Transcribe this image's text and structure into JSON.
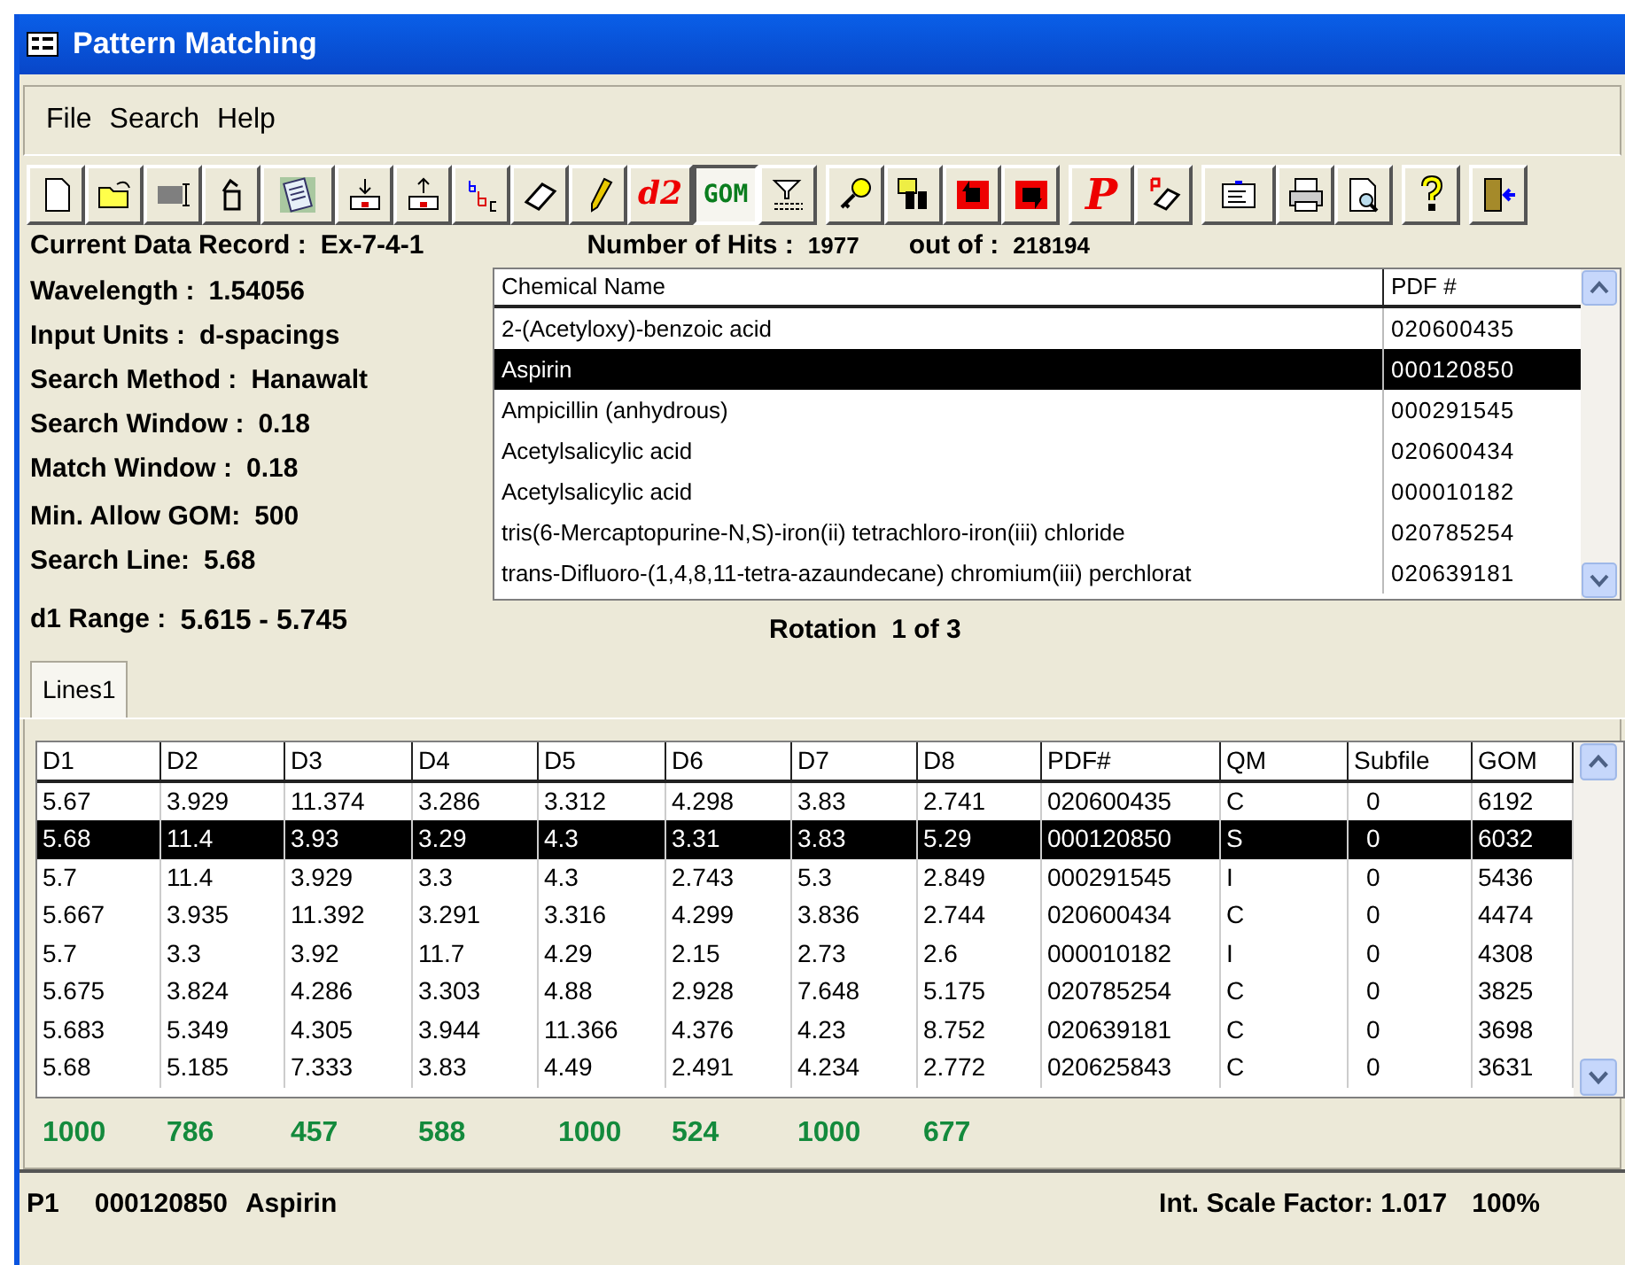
{
  "window": {
    "title": "Pattern Matching"
  },
  "menu": [
    "File",
    "Search",
    "Help"
  ],
  "toolbar": [
    {
      "label": "d2",
      "pressed": false
    },
    {
      "label": "GOM",
      "pressed": true
    },
    {
      "label": "P",
      "pressed": false
    }
  ],
  "record": {
    "label": "Current Data Record :",
    "value": "Ex-7-4-1"
  },
  "hits": {
    "label": "Number of Hits :",
    "value": "1977",
    "total_label": "out of :",
    "total": "218194"
  },
  "parameters": [
    {
      "label": "Wavelength :",
      "value": "1.54056"
    },
    {
      "label": "Input Units :",
      "value": "d-spacings"
    },
    {
      "label": "Search Method :",
      "value": "Hanawalt"
    },
    {
      "label": "Search Window :",
      "value": "0.18"
    },
    {
      "label": "Match Window :",
      "value": "0.18"
    },
    {
      "label": "Min. Allow GOM:",
      "value": "500"
    },
    {
      "label": "Search Line:",
      "value": "5.68"
    },
    {
      "label": "d1 Range :",
      "value": "5.615 - 5.745"
    }
  ],
  "hit_list": {
    "columns": [
      "Chemical Name",
      "PDF #"
    ],
    "rows": [
      {
        "name": "2-(Acetyloxy)-benzoic acid",
        "pdf": "020600435",
        "selected": false
      },
      {
        "name": "Aspirin",
        "pdf": "000120850",
        "selected": true
      },
      {
        "name": "Ampicillin (anhydrous)",
        "pdf": "000291545",
        "selected": false
      },
      {
        "name": "Acetylsalicylic acid",
        "pdf": "020600434",
        "selected": false
      },
      {
        "name": "Acetylsalicylic acid",
        "pdf": "000010182",
        "selected": false
      },
      {
        "name": "tris(6-Mercaptopurine-N,S)-iron(ii) tetrachloro-iron(iii) chloride",
        "pdf": "020785254",
        "selected": false
      },
      {
        "name": "trans-Difluoro-(1,4,8,11-tetra-azaundecane) chromium(iii) perchlorat",
        "pdf": "020639181",
        "selected": false
      }
    ]
  },
  "rotation": "Rotation  1 of 3",
  "tabs": [
    {
      "label": "Lines1",
      "selected": true
    }
  ],
  "lines_table": {
    "columns": [
      "D1",
      "D2",
      "D3",
      "D4",
      "D5",
      "D6",
      "D7",
      "D8",
      "PDF#",
      "QM",
      "Subfile",
      "GOM"
    ],
    "rows": [
      {
        "cells": [
          "5.67",
          "3.929",
          "11.374",
          "3.286",
          "3.312",
          "4.298",
          "3.83",
          "2.741",
          "020600435",
          "C",
          "0",
          "6192"
        ],
        "selected": false
      },
      {
        "cells": [
          "5.68",
          "11.4",
          "3.93",
          "3.29",
          "4.3",
          "3.31",
          "3.83",
          "5.29",
          "000120850",
          "S",
          "0",
          "6032"
        ],
        "selected": true
      },
      {
        "cells": [
          "5.7",
          "11.4",
          "3.929",
          "3.3",
          "4.3",
          "2.743",
          "5.3",
          "2.849",
          "000291545",
          "I",
          "0",
          "5436"
        ],
        "selected": false
      },
      {
        "cells": [
          "5.667",
          "3.935",
          "11.392",
          "3.291",
          "3.316",
          "4.299",
          "3.836",
          "2.744",
          "020600434",
          "C",
          "0",
          "4474"
        ],
        "selected": false
      },
      {
        "cells": [
          "5.7",
          "3.3",
          "3.92",
          "11.7",
          "4.29",
          "2.15",
          "2.73",
          "2.6",
          "000010182",
          "I",
          "0",
          "4308"
        ],
        "selected": false
      },
      {
        "cells": [
          "5.675",
          "3.824",
          "4.286",
          "3.303",
          "4.88",
          "2.928",
          "7.648",
          "5.175",
          "020785254",
          "C",
          "0",
          "3825"
        ],
        "selected": false
      },
      {
        "cells": [
          "5.683",
          "5.349",
          "4.305",
          "3.944",
          "11.366",
          "4.376",
          "4.23",
          "8.752",
          "020639181",
          "C",
          "0",
          "3698"
        ],
        "selected": false
      },
      {
        "cells": [
          "5.68",
          "5.185",
          "7.333",
          "3.83",
          "4.49",
          "2.491",
          "4.234",
          "2.772",
          "020625843",
          "C",
          "0",
          "3631"
        ],
        "selected": false
      }
    ]
  },
  "line_scores": [
    "1000",
    "786",
    "457",
    "588",
    "1000",
    "524",
    "1000",
    "677"
  ],
  "status_bar": {
    "pattern": "P1",
    "pdf": "000120850",
    "name": "Aspirin",
    "scale": "Int. Scale Factor: 1.017",
    "zoom": "100%"
  }
}
